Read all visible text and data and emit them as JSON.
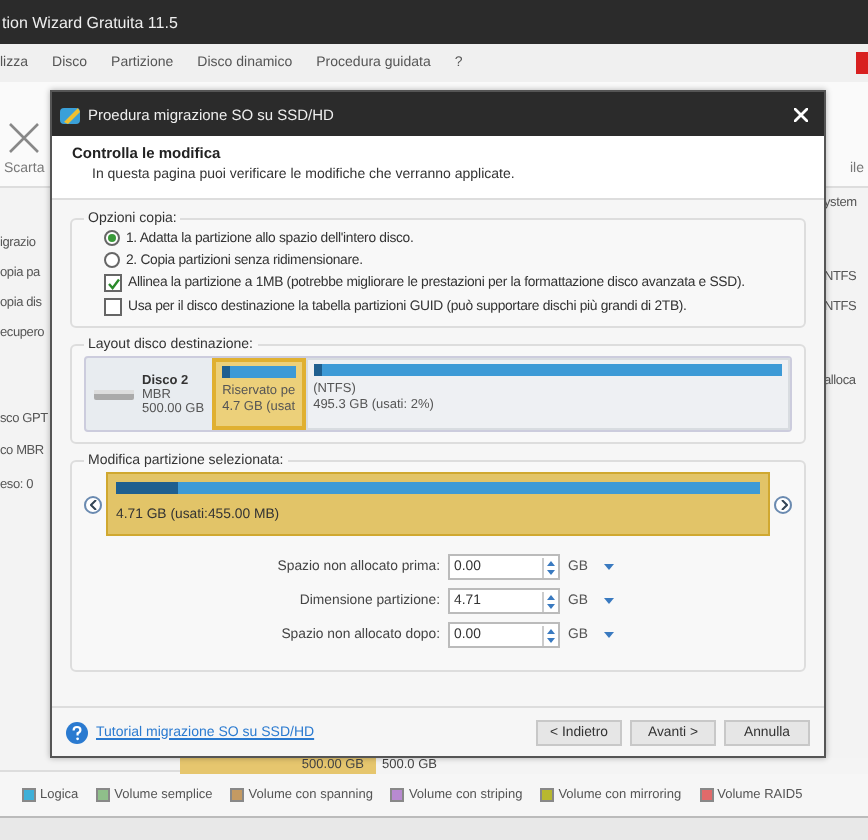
{
  "app": {
    "title": "tion Wizard Gratuita 11.5",
    "menu": [
      "lizza",
      "Disco",
      "Partizione",
      "Disco dinamico",
      "Procedura guidata",
      "?"
    ],
    "toolbar": {
      "left_label": "Scarta",
      "right_label": "ile"
    },
    "sidebar_items": [
      "igrazio",
      "opia pa",
      "opia dis",
      "ecupero",
      "sco GPT",
      "co MBR",
      "eso: 0"
    ],
    "right_items": [
      "ystem",
      "NTFS",
      "NTFS",
      "alloca"
    ],
    "disk_row": {
      "size": "500.00 GB",
      "capacity": "500.0 GB"
    },
    "legend": [
      {
        "label": "Logica",
        "color": "#3fb0d8"
      },
      {
        "label": "Volume semplice",
        "color": "#8fbf8a"
      },
      {
        "label": "Volume con spanning",
        "color": "#c49a62"
      },
      {
        "label": "Volume con striping",
        "color": "#b88ad0"
      },
      {
        "label": "Volume con mirroring",
        "color": "#b8b830"
      },
      {
        "label": "Volume RAID5",
        "color": "#e06a6a"
      }
    ]
  },
  "dialog": {
    "title": "Proedura migrazione SO su SSD/HD",
    "heading": "Controlla le modifica",
    "subheading": "In questa pagina puoi verificare le modifiche che verranno applicate.",
    "copy_options": {
      "title": "Opzioni copia:",
      "options": [
        {
          "kind": "radio",
          "label": "1. Adatta la partizione allo spazio dell'intero disco.",
          "selected": true
        },
        {
          "kind": "radio",
          "label": "2. Copia partizioni senza ridimensionare.",
          "selected": false
        },
        {
          "kind": "checkbox",
          "label": "Allinea la partizione a 1MB (potrebbe migliorare le prestazioni per la formattazione disco avanzata e SSD).",
          "checked": true
        },
        {
          "kind": "checkbox",
          "label": "Usa per il disco destinazione la tabella partizioni GUID (può supportare dischi più grandi di 2TB).",
          "checked": false
        }
      ]
    },
    "layout": {
      "title": "Layout disco destinazione:",
      "disk": {
        "name": "Disco 2",
        "type": "MBR",
        "size": "500.00 GB"
      },
      "partitions": [
        {
          "label": "Riservato pe",
          "detail": "4.7 GB (usat",
          "selected": true,
          "level": 0.1
        },
        {
          "label": "(NTFS)",
          "detail": "495.3 GB (usati: 2%)",
          "selected": false,
          "level": 0.02
        }
      ]
    },
    "edit": {
      "title": "Modifica partizione selezionata:",
      "partition": {
        "detail": "4.71 GB (usati:455.00 MB)",
        "level": 0.095
      },
      "fields": [
        {
          "label": "Spazio non allocato prima:",
          "value": "0.00",
          "unit": "GB"
        },
        {
          "label": "Dimensione partizione:",
          "value": "4.71",
          "unit": "GB"
        },
        {
          "label": "Spazio non allocato dopo:",
          "value": "0.00",
          "unit": "GB"
        }
      ]
    },
    "link": "Tutorial migrazione SO su SSD/HD",
    "buttons": [
      {
        "label": "< Indietro"
      },
      {
        "label": "Avanti >"
      },
      {
        "label": "Annulla"
      }
    ]
  }
}
